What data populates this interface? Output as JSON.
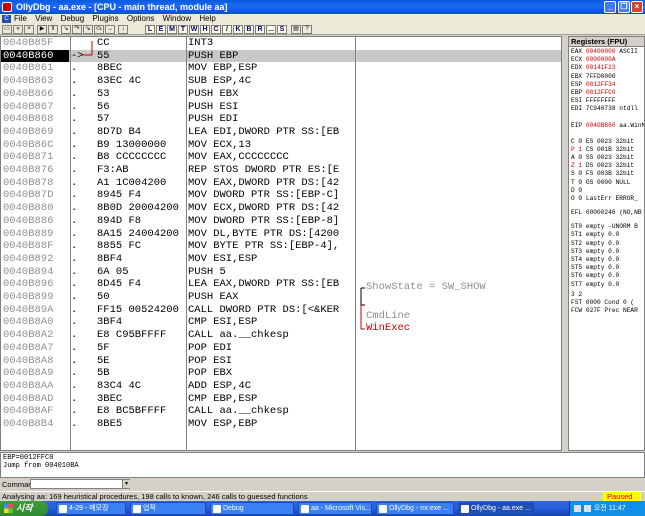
{
  "window": {
    "title": "OllyDbg - aa.exe - [CPU - main thread, module aa]"
  },
  "menu": [
    "File",
    "View",
    "Debug",
    "Plugins",
    "Options",
    "Window",
    "Help"
  ],
  "toolbar": {
    "buttons": [
      "open",
      "restart",
      "close",
      "run",
      "pause",
      "step-into",
      "step-over",
      "trace-into",
      "trace-over",
      "execute-till-return",
      "goto"
    ],
    "letters": [
      "L",
      "E",
      "M",
      "T",
      "W",
      "H",
      "C",
      "/",
      "K",
      "B",
      "R",
      "...",
      "S"
    ]
  },
  "disasm": {
    "rows": [
      {
        "addr": "0040B85F",
        "mark": "",
        "hex": "CC",
        "dis": "INT3"
      },
      {
        "addr": "0040B860",
        "mark": "->",
        "hex": "55",
        "dis": "PUSH EBP",
        "selected": true
      },
      {
        "addr": "0040B861",
        "mark": ".",
        "hex": "8BEC",
        "dis": "MOV EBP,ESP"
      },
      {
        "addr": "0040B863",
        "mark": ".",
        "hex": "83EC 4C",
        "dis": "SUB ESP,4C"
      },
      {
        "addr": "0040B866",
        "mark": ".",
        "hex": "53",
        "dis": "PUSH EBX"
      },
      {
        "addr": "0040B867",
        "mark": ".",
        "hex": "56",
        "dis": "PUSH ESI"
      },
      {
        "addr": "0040B868",
        "mark": ".",
        "hex": "57",
        "dis": "PUSH EDI"
      },
      {
        "addr": "0040B869",
        "mark": ".",
        "hex": "8D7D B4",
        "dis": "LEA EDI,DWORD PTR SS:[EB"
      },
      {
        "addr": "0040B86C",
        "mark": ".",
        "hex": "B9 13000000",
        "dis": "MOV ECX,13"
      },
      {
        "addr": "0040B871",
        "mark": ".",
        "hex": "B8 CCCCCCCC",
        "dis": "MOV EAX,CCCCCCCC"
      },
      {
        "addr": "0040B876",
        "mark": ".",
        "hex": "F3:AB",
        "dis": "REP STOS DWORD PTR ES:[E"
      },
      {
        "addr": "0040B878",
        "mark": ".",
        "hex": "A1 1C004200",
        "dis": "MOV EAX,DWORD PTR DS:[42"
      },
      {
        "addr": "0040B87D",
        "mark": ".",
        "hex": "8945 F4",
        "dis": "MOV DWORD PTR SS:[EBP-C]"
      },
      {
        "addr": "0040B880",
        "mark": ".",
        "hex": "8B0D 20004200",
        "dis": "MOV ECX,DWORD PTR DS:[42"
      },
      {
        "addr": "0040B886",
        "mark": ".",
        "hex": "894D F8",
        "dis": "MOV DWORD PTR SS:[EBP-8]"
      },
      {
        "addr": "0040B889",
        "mark": ".",
        "hex": "8A15 24004200",
        "dis": "MOV DL,BYTE PTR DS:[4200"
      },
      {
        "addr": "0040B88F",
        "mark": ".",
        "hex": "8855 FC",
        "dis": "MOV BYTE PTR SS:[EBP-4],"
      },
      {
        "addr": "0040B892",
        "mark": ".",
        "hex": "8BF4",
        "dis": "MOV ESI,ESP"
      },
      {
        "addr": "0040B894",
        "mark": ".",
        "hex": "6A 05",
        "dis": "PUSH 5"
      },
      {
        "addr": "0040B896",
        "mark": ".",
        "hex": "8D45 F4",
        "dis": "LEA EAX,DWORD PTR SS:[EB"
      },
      {
        "addr": "0040B899",
        "mark": ".",
        "hex": "50",
        "dis": "PUSH EAX"
      },
      {
        "addr": "0040B89A",
        "mark": ".",
        "hex": "FF15 00524200",
        "dis": "CALL DWORD PTR DS:[<&KER"
      },
      {
        "addr": "0040B8A0",
        "mark": ".",
        "hex": "3BF4",
        "dis": "CMP ESI,ESP"
      },
      {
        "addr": "0040B8A2",
        "mark": ".",
        "hex": "E8 C95BFFFF",
        "dis": "CALL aa.__chkesp"
      },
      {
        "addr": "0040B8A7",
        "mark": ".",
        "hex": "5F",
        "dis": "POP EDI"
      },
      {
        "addr": "0040B8A8",
        "mark": ".",
        "hex": "5E",
        "dis": "POP ESI"
      },
      {
        "addr": "0040B8A9",
        "mark": ".",
        "hex": "5B",
        "dis": "POP EBX"
      },
      {
        "addr": "0040B8AA",
        "mark": ".",
        "hex": "83C4 4C",
        "dis": "ADD ESP,4C"
      },
      {
        "addr": "0040B8AD",
        "mark": ".",
        "hex": "3BEC",
        "dis": "CMP EBP,ESP"
      },
      {
        "addr": "0040B8AF",
        "mark": ".",
        "hex": "E8 BC5BFFFF",
        "dis": "CALL aa.__chkesp"
      },
      {
        "addr": "0040B8B4",
        "mark": ".",
        "hex": "8BE5",
        "dis": "MOV ESP,EBP"
      }
    ],
    "comments": {
      "showstate": "ShowState = SW_SHOW",
      "cmdline": "CmdLine",
      "winexec": "WinExec"
    }
  },
  "registers": {
    "header": "Registers (FPU)",
    "regs": [
      {
        "n": "EAX",
        "v": "00400000",
        "t": "ASCII",
        "red": true
      },
      {
        "n": "ECX",
        "v": "0000000A",
        "t": "",
        "red": true
      },
      {
        "n": "EDX",
        "v": "00141F23",
        "t": "",
        "red": true
      },
      {
        "n": "EBX",
        "v": "7FFD0000",
        "t": "",
        "red": false
      },
      {
        "n": "ESP",
        "v": "0012FF34",
        "t": "",
        "red": true
      },
      {
        "n": "EBP",
        "v": "0012FFC0",
        "t": "",
        "red": true
      },
      {
        "n": "ESI",
        "v": "FFFFFFFF",
        "t": "",
        "red": false
      },
      {
        "n": "EDI",
        "v": "7C940738",
        "t": "ntdll",
        "red": false
      }
    ],
    "eip": {
      "n": "EIP",
      "v": "0040B860",
      "t": "aa.WinM"
    },
    "flags": [
      {
        "f": "C 0",
        "s": "ES 0023 32bit"
      },
      {
        "f": "P 1",
        "s": "CS 001B 32bit"
      },
      {
        "f": "A 0",
        "s": "SS 0023 32bit"
      },
      {
        "f": "Z 1",
        "s": "DS 0023 32bit"
      },
      {
        "f": "S 0",
        "s": "FS 003B 32bit"
      },
      {
        "f": "T 0",
        "s": "GS 0000 NULL"
      },
      {
        "f": "D 0",
        "s": ""
      },
      {
        "f": "O 0",
        "s": "LastErr ERROR_"
      }
    ],
    "efl": "EFL 00000246 (NO,NB",
    "fpu": [
      "ST0 empty -UNORM B",
      "ST1 empty 0.0",
      "ST2 empty 0.0",
      "ST3 empty 0.0",
      "ST4 empty 0.0",
      "ST5 empty 0.0",
      "ST6 empty 0.0",
      "ST7 empty 0.0"
    ],
    "fpu_footer": [
      "3 2",
      "FST 0000  Cond 0 (",
      "FCW 027F  Prec NEAR"
    ]
  },
  "info": {
    "line1": "EBP=0012FFC0",
    "line2": "Jump from 004010BA"
  },
  "command": {
    "label": "Command",
    "value": ""
  },
  "status": {
    "text": "Analysing aa: 169 heuristical procedures, 198 calls to known, 246 calls to guessed functions",
    "badge": "Paused"
  },
  "taskbar": {
    "start": "시작",
    "items": [
      "4-29 - 메모장",
      "업적",
      "Debug",
      "aa - Microsoft Vis...",
      "OllyDbg - mr.exe ...",
      "OllyDbg - aa.exe ..."
    ],
    "time": "오전 11:47"
  }
}
